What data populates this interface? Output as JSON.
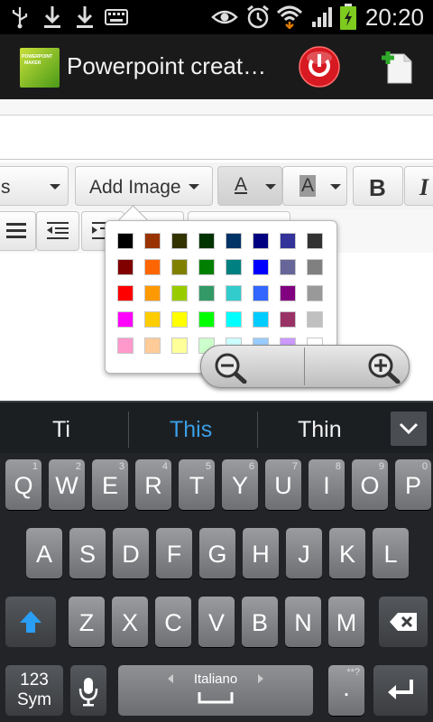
{
  "status_bar": {
    "time": "20:20",
    "icons": [
      "usb-icon",
      "download-icon",
      "download-icon",
      "keyboard-icon",
      "eye-icon",
      "alarm-icon",
      "wifi-icon",
      "signal-icon",
      "battery-charging-icon"
    ]
  },
  "action_bar": {
    "title": "Powerpoint creat…",
    "logo_text_line1": "POWERPOINT",
    "logo_text_line2": "MAKER",
    "icons": [
      "power-icon",
      "new-document-icon"
    ]
  },
  "toolbar": {
    "font_select_label": "s",
    "add_image_label": "Add Image",
    "text_color_label": "A",
    "bg_color_label": "A",
    "bold_label": "B",
    "italic_label": "I"
  },
  "palette": {
    "rows": [
      [
        "#000000",
        "#993300",
        "#333300",
        "#003300",
        "#003366",
        "#000080",
        "#333399",
        "#333333"
      ],
      [
        "#800000",
        "#FF6600",
        "#808000",
        "#008000",
        "#008080",
        "#0000FF",
        "#666699",
        "#808080"
      ],
      [
        "#FF0000",
        "#FF9900",
        "#99CC00",
        "#339966",
        "#33CCCC",
        "#3366FF",
        "#800080",
        "#999999"
      ],
      [
        "#FF00FF",
        "#FFCC00",
        "#FFFF00",
        "#00FF00",
        "#00FFFF",
        "#00CCFF",
        "#993366",
        "#C0C0C0"
      ],
      [
        "#FF99CC",
        "#FFCC99",
        "#FFFF99",
        "#CCFFCC",
        "#CCFFFF",
        "#99CCFF",
        "#CC99FF",
        "#FFFFFF"
      ]
    ]
  },
  "suggestions": [
    "Ti",
    "This",
    "Thin"
  ],
  "suggestion_highlight_color": "#3a9ee6",
  "keyboard": {
    "row1": [
      [
        "Q",
        "1"
      ],
      [
        "W",
        "2"
      ],
      [
        "E",
        "3"
      ],
      [
        "R",
        "4"
      ],
      [
        "T",
        "5"
      ],
      [
        "Y",
        "6"
      ],
      [
        "U",
        "7"
      ],
      [
        "I",
        "8"
      ],
      [
        "O",
        "9"
      ],
      [
        "P",
        "0"
      ]
    ],
    "row2": [
      "A",
      "S",
      "D",
      "F",
      "G",
      "H",
      "J",
      "K",
      "L"
    ],
    "row3": [
      "Z",
      "X",
      "C",
      "V",
      "B",
      "N",
      "M"
    ],
    "sym_label_1": "123",
    "sym_label_2": "Sym",
    "space_label": "Italiano",
    "period_label": ".",
    "period_hint": "**?",
    "shift_color": "#2a9df4"
  }
}
